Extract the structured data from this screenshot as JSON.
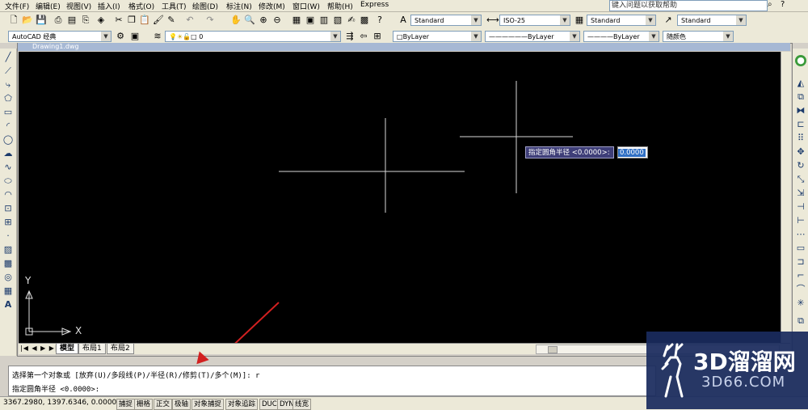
{
  "menu": {
    "items": [
      "文件(F)",
      "编辑(E)",
      "视图(V)",
      "插入(I)",
      "格式(O)",
      "工具(T)",
      "绘图(D)",
      "标注(N)",
      "修改(M)",
      "窗口(W)",
      "帮助(H)",
      "Express"
    ],
    "help_placeholder": "键入问题以获取帮助"
  },
  "toolbar": {
    "text_style": "Standard",
    "dim_style": "ISO-25",
    "table_style": "Standard",
    "multileader_style": "Standard",
    "workspace": "AutoCAD 经典",
    "layer": "0",
    "color": "ByLayer",
    "linetype": "ByLayer",
    "lineweight": "ByLayer",
    "plot_style": "随颜色"
  },
  "drawing": {
    "title": "Drawing1.dwg",
    "ucs_y": "Y",
    "ucs_x": "X"
  },
  "tabs": [
    "模型",
    "布局1",
    "布局2"
  ],
  "command": {
    "line1": "选择第一个对象或 [放弃(U)/多段线(P)/半径(R)/修剪(T)/多个(M)]: r",
    "line2": "指定圆角半径 <0.0000>:"
  },
  "dynamic_input": {
    "prompt": "指定圆角半径 <0.0000>:",
    "value": "0.0000"
  },
  "status": {
    "coords": "3367.2980, 1397.6346, 0.0000",
    "buttons": [
      "捕捉",
      "栅格",
      "正交",
      "极轴",
      "对象捕捉",
      "对象追踪",
      "DUCS",
      "DYN",
      "线宽"
    ]
  },
  "watermark": {
    "brand": "3D溜溜网",
    "url": "3D66.COM"
  },
  "colors": {
    "canvas_bg": "#000000",
    "crosshair": "#d8d8d8",
    "arrow": "#d22020",
    "watermark_bg": "#1a2b5e"
  }
}
